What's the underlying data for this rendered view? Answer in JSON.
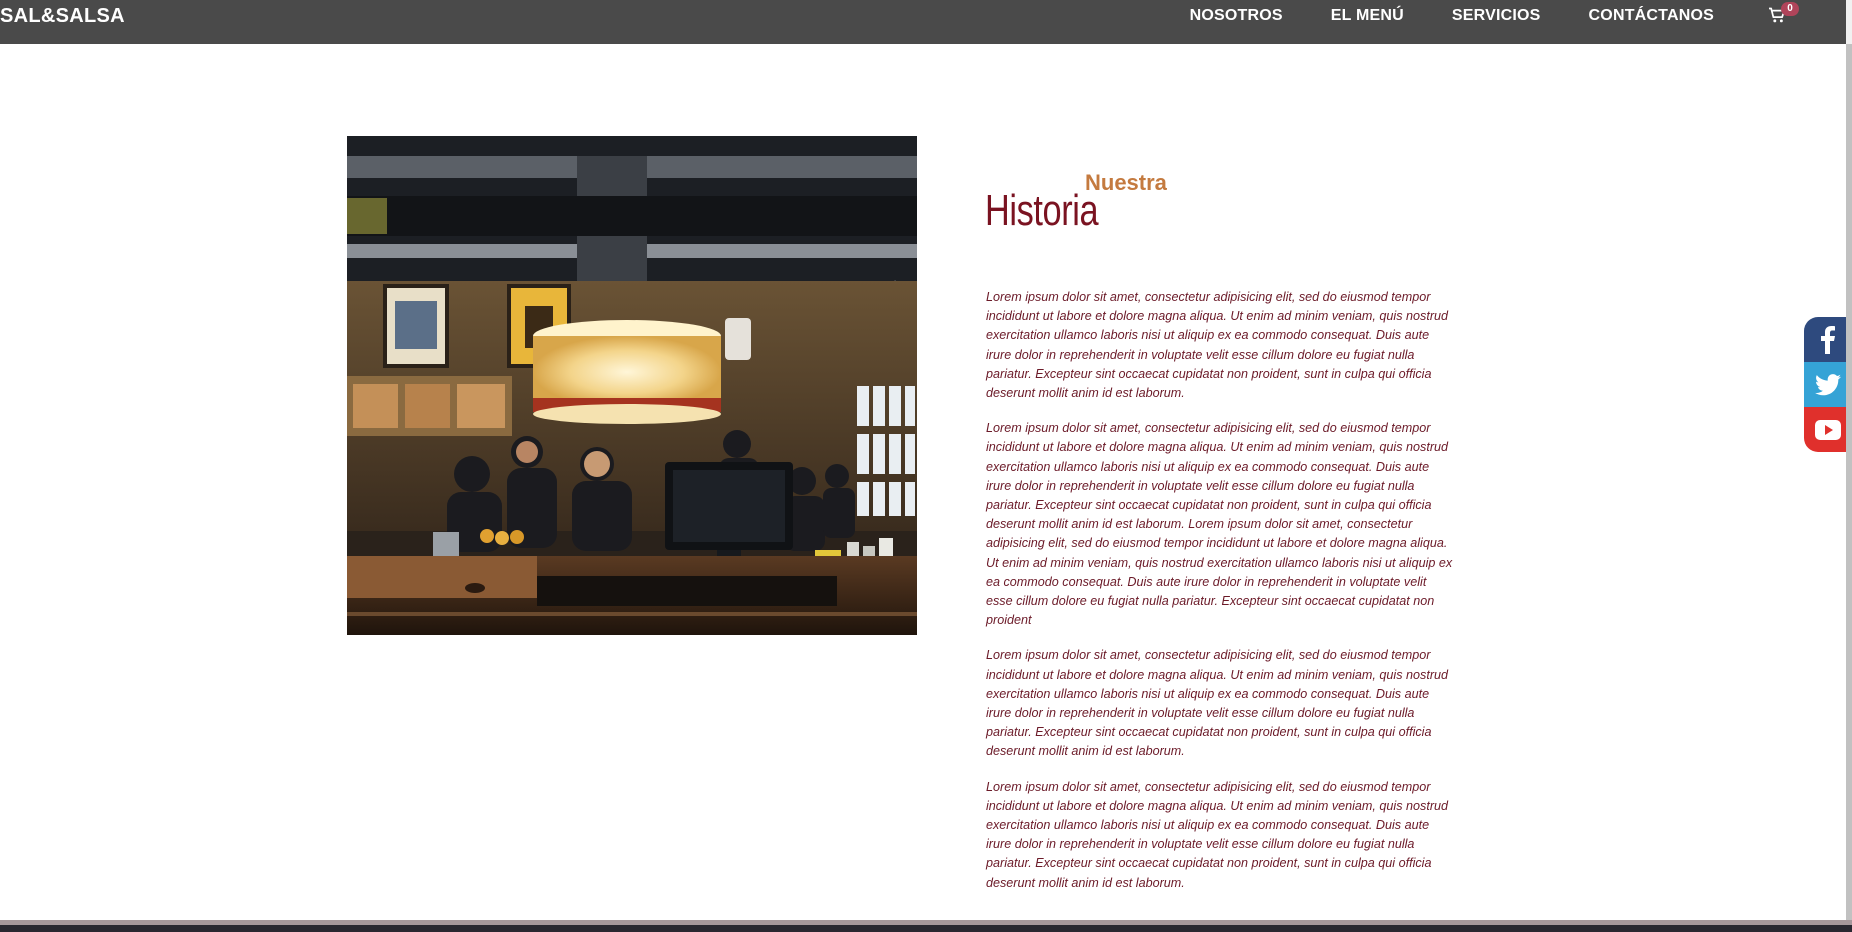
{
  "navbar": {
    "brand": "SAL&SALSA",
    "links": [
      "NOSOTROS",
      "EL MENÚ",
      "SERVICIOS",
      "CONTÁCTANOS"
    ],
    "cart_count": "0",
    "cart_icon": "cart-icon"
  },
  "about": {
    "eyebrow": "Nuestra",
    "title": "Historia",
    "paragraphs": [
      "Lorem ipsum dolor sit amet, consectetur adipisicing elit, sed do eiusmod tempor incididunt ut labore et dolore magna aliqua. Ut enim ad minim veniam, quis nostrud exercitation ullamco laboris nisi ut aliquip ex ea commodo consequat. Duis aute irure dolor in reprehenderit in voluptate velit esse cillum dolore eu fugiat nulla pariatur. Excepteur sint occaecat cupidatat non proident, sunt in culpa qui officia deserunt mollit anim id est laborum.",
      "Lorem ipsum dolor sit amet, consectetur adipisicing elit, sed do eiusmod tempor incididunt ut labore et dolore magna aliqua. Ut enim ad minim veniam, quis nostrud exercitation ullamco laboris nisi ut aliquip ex ea commodo consequat. Duis aute irure dolor in reprehenderit in voluptate velit esse cillum dolore eu fugiat nulla pariatur. Excepteur sint occaecat cupidatat non proident, sunt in culpa qui officia deserunt mollit anim id est laborum. Lorem ipsum dolor sit amet, consectetur adipisicing elit, sed do eiusmod tempor incididunt ut labore et dolore magna aliqua. Ut enim ad minim veniam, quis nostrud exercitation ullamco laboris nisi ut aliquip ex ea commodo consequat. Duis aute irure dolor in reprehenderit in voluptate velit esse cillum dolore eu fugiat nulla pariatur. Excepteur sint occaecat cupidatat non proident",
      "Lorem ipsum dolor sit amet, consectetur adipisicing elit, sed do eiusmod tempor incididunt ut labore et dolore magna aliqua. Ut enim ad minim veniam, quis nostrud exercitation ullamco laboris nisi ut aliquip ex ea commodo consequat. Duis aute irure dolor in reprehenderit in voluptate velit esse cillum dolore eu fugiat nulla pariatur. Excepteur sint occaecat cupidatat non proident, sunt in culpa qui officia deserunt mollit anim id est laborum.",
      "Lorem ipsum dolor sit amet, consectetur adipisicing elit, sed do eiusmod tempor incididunt ut labore et dolore magna aliqua. Ut enim ad minim veniam, quis nostrud exercitation ullamco laboris nisi ut aliquip ex ea commodo consequat. Duis aute irure dolor in reprehenderit in voluptate velit esse cillum dolore eu fugiat nulla pariatur. Excepteur sint occaecat cupidatat non proident, sunt in culpa qui officia deserunt mollit anim id est laborum."
    ],
    "image_icon": "restaurant-photo"
  },
  "social": {
    "icons": [
      "facebook-icon",
      "twitter-icon",
      "youtube-icon"
    ]
  },
  "colors": {
    "navbar_bg": "#4a4a4a",
    "accent_orange": "#c47a3f",
    "title_maroon": "#7a1321",
    "body_text": "#6b1a28",
    "facebook": "#2e4a7e",
    "twitter": "#35a3d6",
    "youtube": "#e0302c"
  }
}
